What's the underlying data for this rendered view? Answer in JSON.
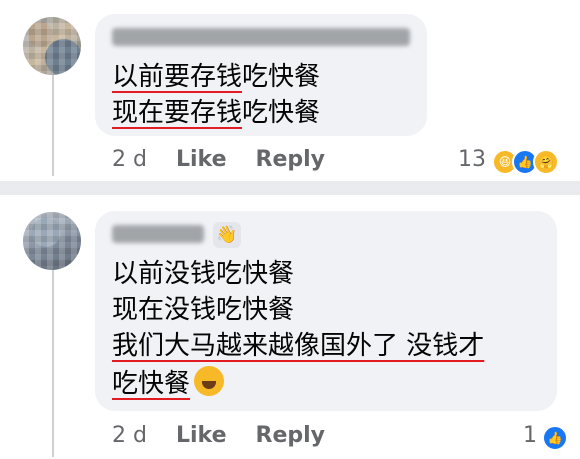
{
  "comments": [
    {
      "lines": [
        "以前要存钱吃快餐",
        "现在要存钱吃快餐"
      ],
      "underlined": [
        "以前要存钱",
        "现在要存钱"
      ],
      "rest": [
        "吃快餐",
        "吃快餐"
      ],
      "meta": {
        "time": "2 d",
        "like": "Like",
        "reply": "Reply"
      },
      "reactions": {
        "count": "13",
        "icons": [
          "haha-icon",
          "like-icon",
          "care-icon"
        ]
      }
    },
    {
      "lines": [
        "以前没钱吃快餐",
        "现在没钱吃快餐",
        "我们大马越来越像国外了 没钱才",
        "吃快餐"
      ],
      "meta": {
        "time": "2 d",
        "like": "Like",
        "reply": "Reply"
      },
      "reactions": {
        "count": "1",
        "icons": [
          "like-icon"
        ]
      }
    }
  ],
  "colors": {
    "background": "#e9ebee",
    "bubble": "#f0f2f5",
    "underline": "#e31b23",
    "meta_text": "#65676b",
    "like_blue": "#1877f2",
    "haha_yellow": "#f7b928"
  }
}
